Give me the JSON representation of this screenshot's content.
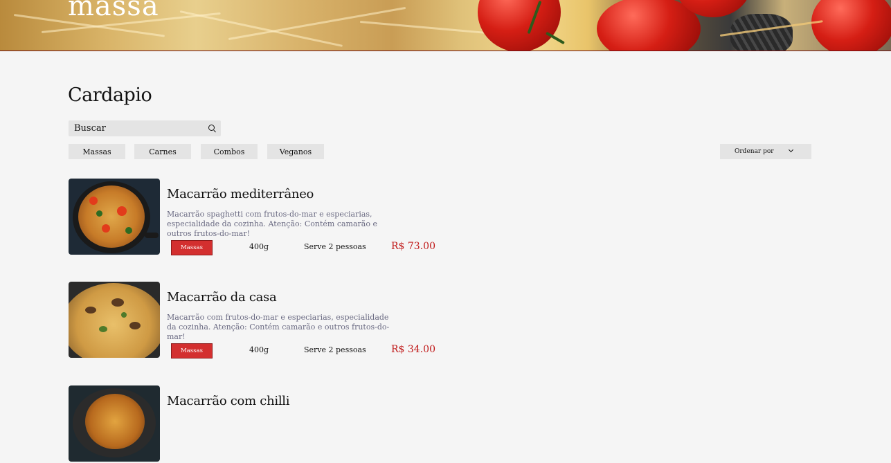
{
  "brand": "massa",
  "page_title": "Cardapio",
  "search": {
    "placeholder": "Buscar"
  },
  "filters": [
    "Massas",
    "Carnes",
    "Combos",
    "Veganos"
  ],
  "sort_label": "Ordenar por",
  "items": [
    {
      "name": "Macarrão mediterrâneo",
      "description": "Macarrão spaghetti com frutos-do-mar e especiarias, especialidade da cozinha. Atenção: Contém camarão e outros frutos-do-mar!",
      "category": "Massas",
      "weight": "400g",
      "serves": "Serve 2 pessoas",
      "price": "R$ 73.00"
    },
    {
      "name": "Macarrão da casa",
      "description": "Macarrão com frutos-do-mar e especiarias, especialidade da cozinha. Atenção: Contém camarão e outros frutos-do-mar!",
      "category": "Massas",
      "weight": "400g",
      "serves": "Serve 2 pessoas",
      "price": "R$ 34.00"
    },
    {
      "name": "Macarrão com chilli"
    }
  ]
}
